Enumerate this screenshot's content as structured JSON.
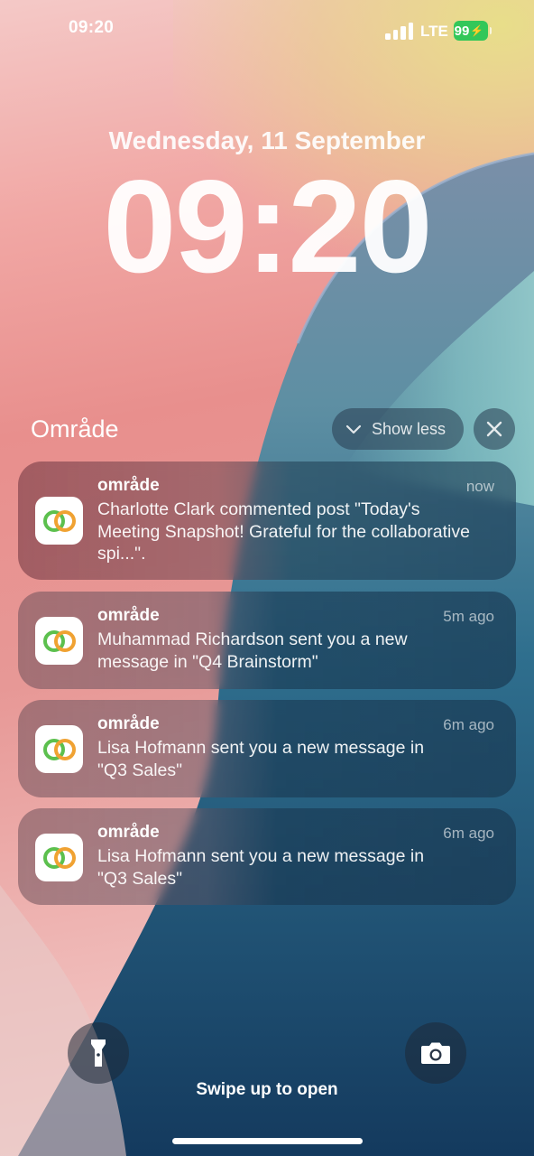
{
  "status_bar": {
    "time": "09:20",
    "network": "LTE",
    "battery": "99",
    "battery_color": "#33c759"
  },
  "lock_screen": {
    "date": "Wednesday, 11 September",
    "time": "09:20"
  },
  "notification_group": {
    "title": "Område",
    "show_less_label": "Show less",
    "notifications": [
      {
        "app": "område",
        "time": "now",
        "body": "Charlotte Clark commented post \"Today's Meeting Snapshot! Grateful for the collaborative spi...\"."
      },
      {
        "app": "område",
        "time": "5m ago",
        "body": "Muhammad Richardson sent you a new message in \"Q4 Brainstorm\""
      },
      {
        "app": "område",
        "time": "6m ago",
        "body": "Lisa Hofmann sent you a new message in \"Q3 Sales\""
      },
      {
        "app": "område",
        "time": "6m ago",
        "body": "Lisa Hofmann sent you a new message in \"Q3 Sales\""
      }
    ]
  },
  "bottom": {
    "swipe_label": "Swipe up to open"
  },
  "icons": {
    "app_icon": "overlapping-rings-icon",
    "flashlight": "flashlight-icon",
    "camera": "camera-icon",
    "chevron": "chevron-down-icon",
    "close": "close-icon"
  }
}
